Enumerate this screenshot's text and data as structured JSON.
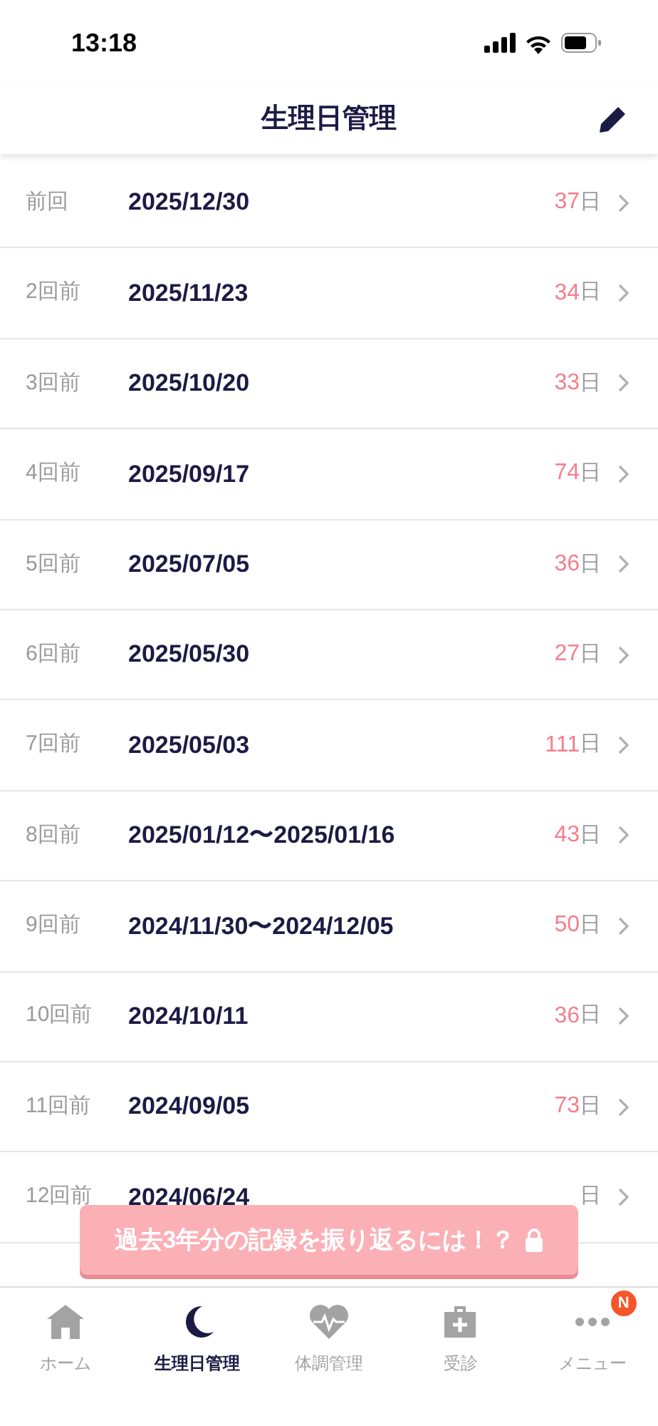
{
  "status_bar": {
    "time": "13:18"
  },
  "header": {
    "title": "生理日管理"
  },
  "records": [
    {
      "label": "前回",
      "date": "2025/12/30",
      "days": "37",
      "unit": "日"
    },
    {
      "label": "2回前",
      "date": "2025/11/23",
      "days": "34",
      "unit": "日"
    },
    {
      "label": "3回前",
      "date": "2025/10/20",
      "days": "33",
      "unit": "日"
    },
    {
      "label": "4回前",
      "date": "2025/09/17",
      "days": "74",
      "unit": "日"
    },
    {
      "label": "5回前",
      "date": "2025/07/05",
      "days": "36",
      "unit": "日"
    },
    {
      "label": "6回前",
      "date": "2025/05/30",
      "days": "27",
      "unit": "日"
    },
    {
      "label": "7回前",
      "date": "2025/05/03",
      "days": "111",
      "unit": "日"
    },
    {
      "label": "8回前",
      "date": "2025/01/12〜2025/01/16",
      "days": "43",
      "unit": "日"
    },
    {
      "label": "9回前",
      "date": "2024/11/30〜2024/12/05",
      "days": "50",
      "unit": "日"
    },
    {
      "label": "10回前",
      "date": "2024/10/11",
      "days": "36",
      "unit": "日"
    },
    {
      "label": "11回前",
      "date": "2024/09/05",
      "days": "73",
      "unit": "日"
    },
    {
      "label": "12回前",
      "date": "2024/06/24",
      "unit": "日"
    }
  ],
  "banner": {
    "text": "過去3年分の記録を振り返るには！？"
  },
  "tab_bar": [
    {
      "kind": "home",
      "label": "ホーム",
      "selected": false
    },
    {
      "kind": "moon",
      "label": "生理日管理",
      "selected": true
    },
    {
      "kind": "heart",
      "label": "体調管理",
      "selected": false
    },
    {
      "kind": "clinic",
      "label": "受診",
      "selected": false
    },
    {
      "kind": "menu",
      "label": "メニュー",
      "selected": false,
      "badge": "N"
    }
  ]
}
